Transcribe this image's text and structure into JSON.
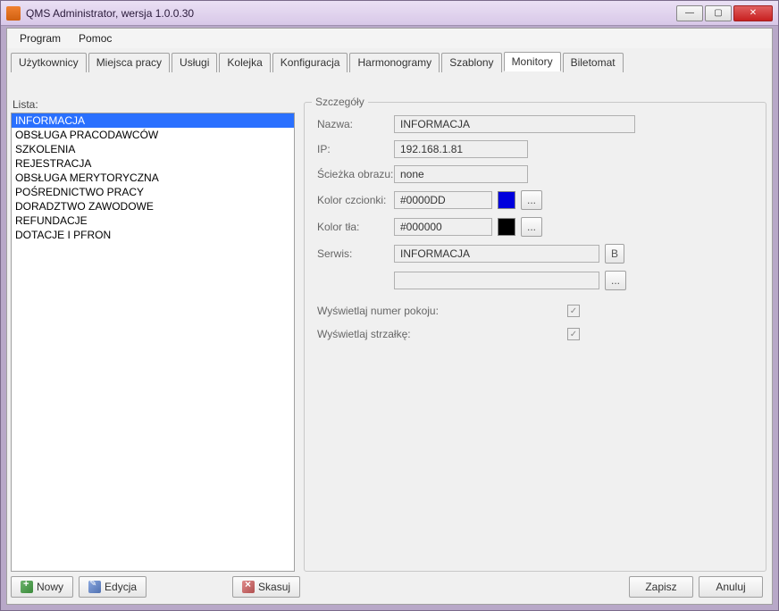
{
  "window": {
    "title": "QMS Administrator, wersja 1.0.0.30"
  },
  "menu": {
    "program": "Program",
    "pomoc": "Pomoc"
  },
  "tabs": {
    "uzytkownicy": "Użytkownicy",
    "miejsca_pracy": "Miejsca pracy",
    "uslugi": "Usługi",
    "kolejka": "Kolejka",
    "konfiguracja": "Konfiguracja",
    "harmonogramy": "Harmonogramy",
    "szablony": "Szablony",
    "monitory": "Monitory",
    "biletomat": "Biletomat"
  },
  "list": {
    "label": "Lista:",
    "items": [
      "INFORMACJA",
      "OBSŁUGA PRACODAWCÓW",
      "SZKOLENIA",
      "REJESTRACJA",
      "OBSŁUGA MERYTORYCZNA",
      "POŚREDNICTWO PRACY",
      "DORADZTWO ZAWODOWE",
      "REFUNDACJE",
      "DOTACJE I PFRON"
    ],
    "selected_index": 0
  },
  "details": {
    "title": "Szczegóły",
    "nazwa_label": "Nazwa:",
    "nazwa_value": "INFORMACJA",
    "ip_label": "IP:",
    "ip_value": "192.168.1.81",
    "sciezka_label": "Ścieżka obrazu:",
    "sciezka_value": "none",
    "kolor_czcionki_label": "Kolor czcionki:",
    "kolor_czcionki_value": "#0000DD",
    "kolor_tla_label": "Kolor tła:",
    "kolor_tla_value": "#000000",
    "serwis_label": "Serwis:",
    "serwis_value": "INFORMACJA",
    "serwis2_value": "",
    "serwis_b_label": "B",
    "dots_label": "...",
    "wysw_pokoju_label": "Wyświetlaj numer pokoju:",
    "wysw_pokoju_checked": true,
    "wysw_strzalke_label": "Wyświetlaj strzałkę:",
    "wysw_strzalke_checked": true
  },
  "buttons": {
    "nowy": "Nowy",
    "edycja": "Edycja",
    "skasuj": "Skasuj",
    "zapisz": "Zapisz",
    "anuluj": "Anuluj"
  },
  "colors": {
    "font_swatch": "#0000DD",
    "bg_swatch": "#000000"
  }
}
